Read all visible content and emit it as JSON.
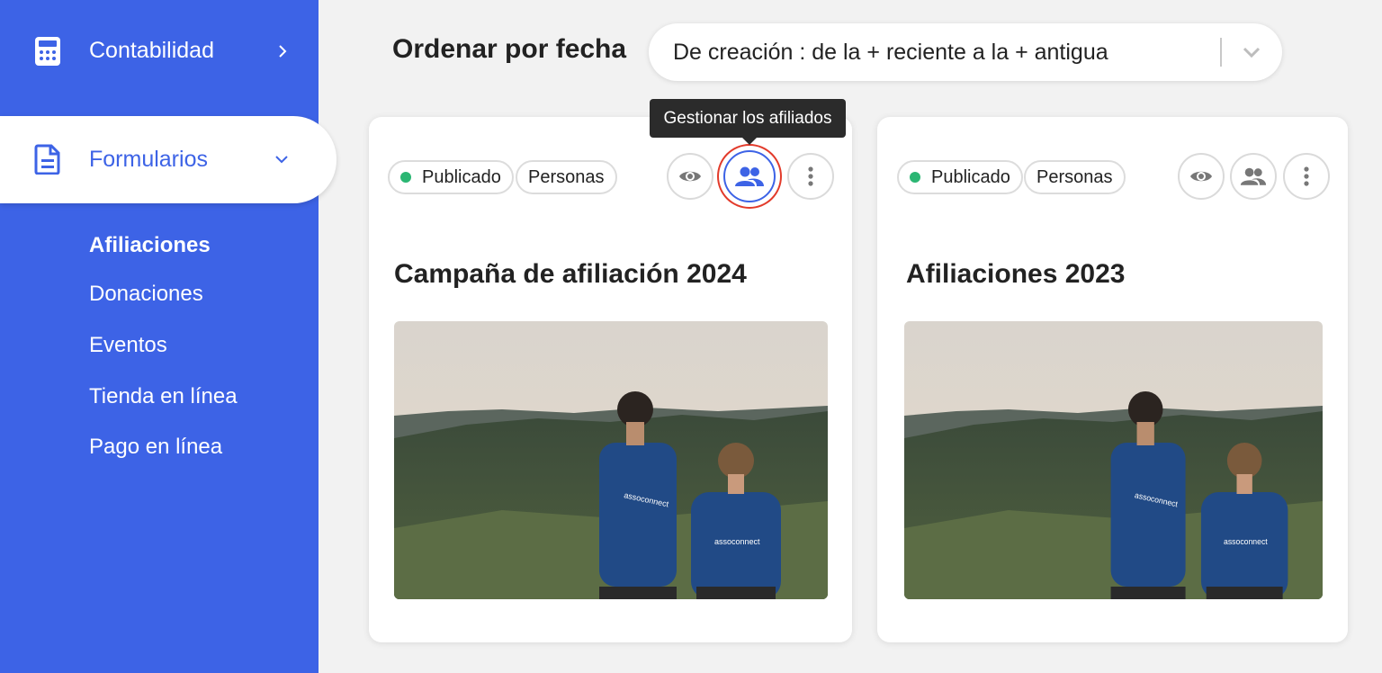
{
  "sidebar": {
    "items": [
      {
        "label": "Contabilidad",
        "icon": "calculator-icon",
        "chevron": "chevron-right-icon"
      },
      {
        "label": "Formularios",
        "icon": "document-icon",
        "chevron": "chevron-down-icon"
      }
    ],
    "subitems": [
      {
        "label": "Afiliaciones",
        "active": true
      },
      {
        "label": "Donaciones"
      },
      {
        "label": "Eventos"
      },
      {
        "label": "Tienda en línea"
      },
      {
        "label": "Pago en línea"
      }
    ]
  },
  "sort": {
    "label": "Ordenar por fecha",
    "selected": "De creación : de la + reciente a la + antigua"
  },
  "tooltip": {
    "text": "Gestionar los afiliados"
  },
  "cards": [
    {
      "status": "Publicado",
      "type": "Personas",
      "title": "Campaña de afiliación 2024",
      "shirt_text": "assoconnect"
    },
    {
      "status": "Publicado",
      "type": "Personas",
      "title": "Afiliaciones 2023",
      "shirt_text": "assoconnect"
    }
  ],
  "colors": {
    "sidebar_bg": "#3d63e6",
    "accent": "#3d63e6",
    "status_dot": "#2bb673",
    "highlight_ring": "#e23a2a",
    "page_bg": "#f2f2f2"
  }
}
